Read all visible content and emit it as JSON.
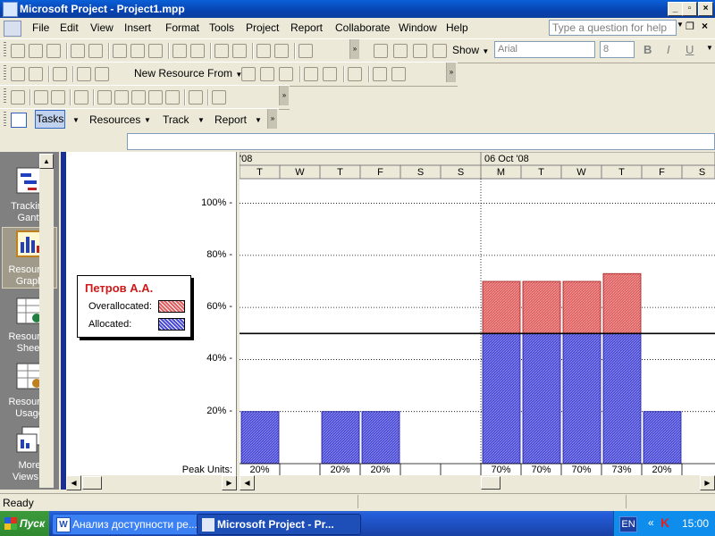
{
  "window": {
    "title": "Microsoft Project - Project1.mpp"
  },
  "menu": [
    "File",
    "Edit",
    "View",
    "Insert",
    "Format",
    "Tools",
    "Project",
    "Report",
    "Collaborate",
    "Window",
    "Help"
  ],
  "help_box": {
    "placeholder": "Type a question for help"
  },
  "toolbar1": {
    "show_label": "Show",
    "font_name": "Arial",
    "font_size": "8",
    "bold": "B",
    "italic": "I",
    "underline": "U"
  },
  "toolbar2": {
    "new_resource_from": "New Resource From"
  },
  "guide_toolbar": {
    "tasks": "Tasks",
    "resources": "Resources",
    "track": "Track",
    "report": "Report"
  },
  "view_bar": {
    "items": [
      {
        "label1": "Tracking",
        "label2": "Gantt"
      },
      {
        "label1": "Resource",
        "label2": "Graph"
      },
      {
        "label1": "Resource",
        "label2": "Sheet"
      },
      {
        "label1": "Resource",
        "label2": "Usage"
      },
      {
        "label1": "More",
        "label2": "Views..."
      }
    ]
  },
  "legend": {
    "resource_name": "Петров А.А.",
    "overallocated_label": "Overallocated:",
    "allocated_label": "Allocated:",
    "overallocated_color": "#e06060",
    "allocated_color": "#4a4ad8",
    "peak_units_label": "Peak Units:"
  },
  "chart_data": {
    "type": "bar",
    "week_labels": [
      "'08",
      "06 Oct '08"
    ],
    "categories": [
      "T",
      "W",
      "T",
      "F",
      "S",
      "S",
      "M",
      "T",
      "W",
      "T",
      "F",
      "S"
    ],
    "series": [
      {
        "name": "Allocated",
        "values": [
          20,
          0,
          20,
          20,
          0,
          0,
          50,
          50,
          50,
          50,
          20,
          0
        ]
      },
      {
        "name": "Overallocated",
        "values": [
          0,
          0,
          0,
          0,
          0,
          0,
          20,
          20,
          20,
          23,
          0,
          0
        ]
      }
    ],
    "peak_units": [
      "20%",
      "",
      "20%",
      "20%",
      "",
      "",
      "70%",
      "70%",
      "70%",
      "73%",
      "20%",
      ""
    ],
    "y_ticks": [
      "100%",
      "80%",
      "60%",
      "40%",
      "20%"
    ],
    "ylim": [
      0,
      110
    ],
    "max_units_line": 50,
    "grid": true
  },
  "status": {
    "text": "Ready"
  },
  "taskbar": {
    "start": "Пуск",
    "items": [
      "Анализ доступности ре...",
      "Microsoft Project - Pr..."
    ],
    "lang": "EN",
    "clock": "15:00"
  }
}
